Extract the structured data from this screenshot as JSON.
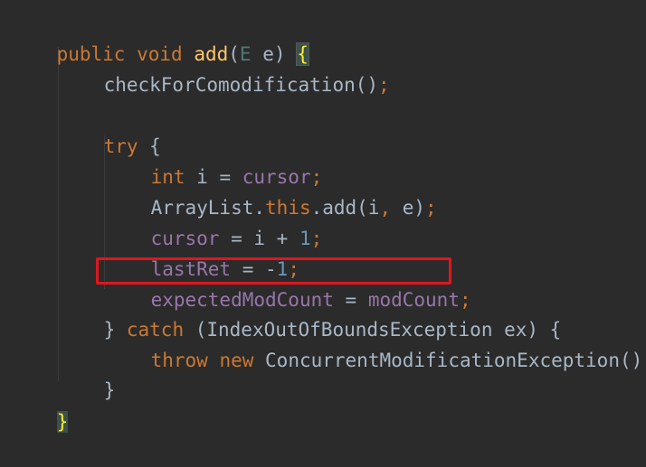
{
  "code": {
    "l1": {
      "public": "public",
      "void": "void",
      "method": "add",
      "open_paren": "(",
      "type_param": "E",
      "arg": " e",
      "close_paren": ")",
      "brace": "{"
    },
    "l2": {
      "text": "checkForComodification",
      "rest": "()",
      "semi": ";"
    },
    "l4": {
      "try": "try",
      "brace": " {"
    },
    "l5": {
      "int": "int",
      "decl": " i = ",
      "cursor": "cursor",
      "semi": ";"
    },
    "l6": {
      "cls": "ArrayList.",
      "this": "this",
      "call": ".add(i",
      "comma": ",",
      "arg": " e)",
      "semi": ";"
    },
    "l7": {
      "cursor": "cursor",
      "op": " = i + ",
      "one": "1",
      "semi": ";"
    },
    "l8": {
      "lastRet": "lastRet",
      "op": " = -",
      "one": "1",
      "semi": ";"
    },
    "l9": {
      "expected": "expectedModCount",
      "op": " = ",
      "mod": "modCount",
      "semi": ";"
    },
    "l10": {
      "close": "} ",
      "catch": "catch",
      "rest": " (IndexOutOfBoundsException ex) {"
    },
    "l11": {
      "throw": "throw",
      "new": "new",
      "exc": " ConcurrentModificationException()",
      "semi": ";"
    },
    "l12": {
      "close": "}"
    },
    "l13": {
      "close": "}"
    }
  },
  "colors": {
    "background": "#2b2b2b",
    "keyword": "#cc7832",
    "method": "#ffc66d",
    "field": "#9876aa",
    "number": "#6897bb",
    "plain": "#a9b7c6",
    "highlight_border": "#e0161e"
  }
}
